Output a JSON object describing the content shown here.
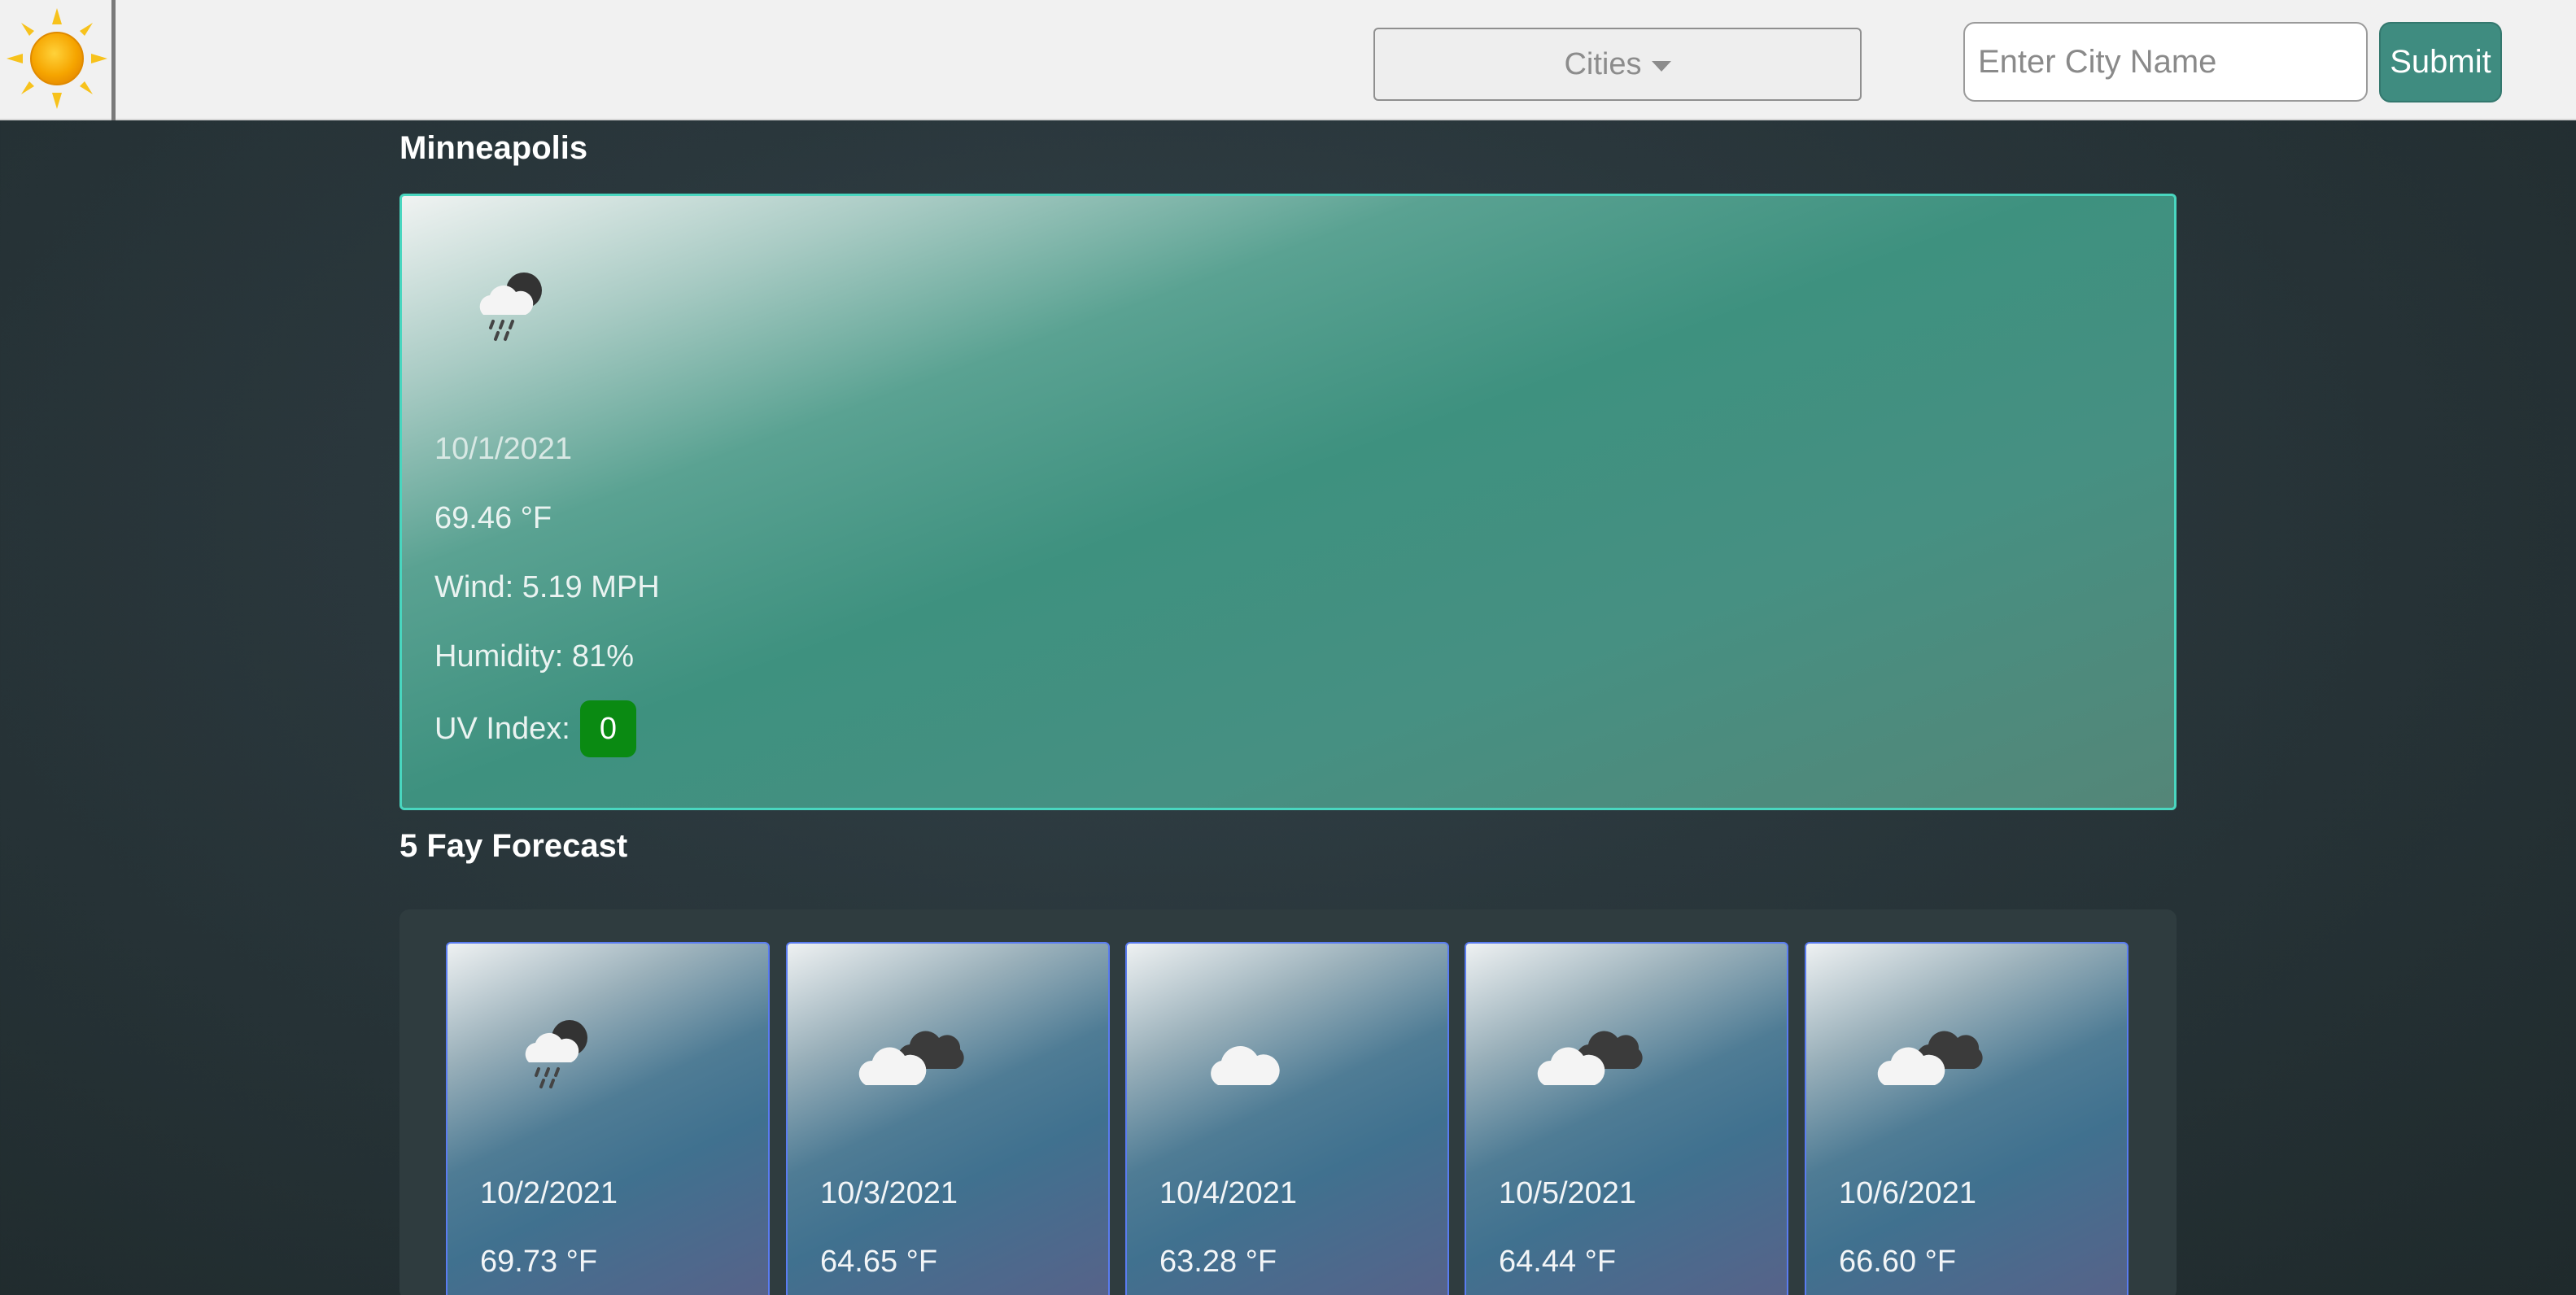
{
  "header": {
    "dropdown_label": "Cities",
    "input_placeholder": "Enter City Name",
    "input_value": "",
    "submit_label": "Submit"
  },
  "current": {
    "city": "Minneapolis",
    "icon": "rain-night-icon",
    "date": "10/1/2021",
    "temp": "69.46 °F",
    "wind": "Wind: 5.19 MPH",
    "humidity": "Humidity: 81%",
    "uv_label": "UV Index:",
    "uv_value": "0",
    "uv_color": "#0a8a12"
  },
  "forecast": {
    "title": "5 Fay Forecast",
    "days": [
      {
        "date": "10/2/2021",
        "temp": "69.73 °F",
        "icon": "rain-night-icon"
      },
      {
        "date": "10/3/2021",
        "temp": "64.65 °F",
        "icon": "broken-clouds-icon"
      },
      {
        "date": "10/4/2021",
        "temp": "63.28 °F",
        "icon": "cloud-icon"
      },
      {
        "date": "10/5/2021",
        "temp": "64.44 °F",
        "icon": "broken-clouds-icon"
      },
      {
        "date": "10/6/2021",
        "temp": "66.60 °F",
        "icon": "broken-clouds-icon"
      }
    ]
  },
  "colors": {
    "accent": "#3f8c80",
    "card_border": "#49d6bf",
    "forecast_border": "#5a7cf0"
  }
}
